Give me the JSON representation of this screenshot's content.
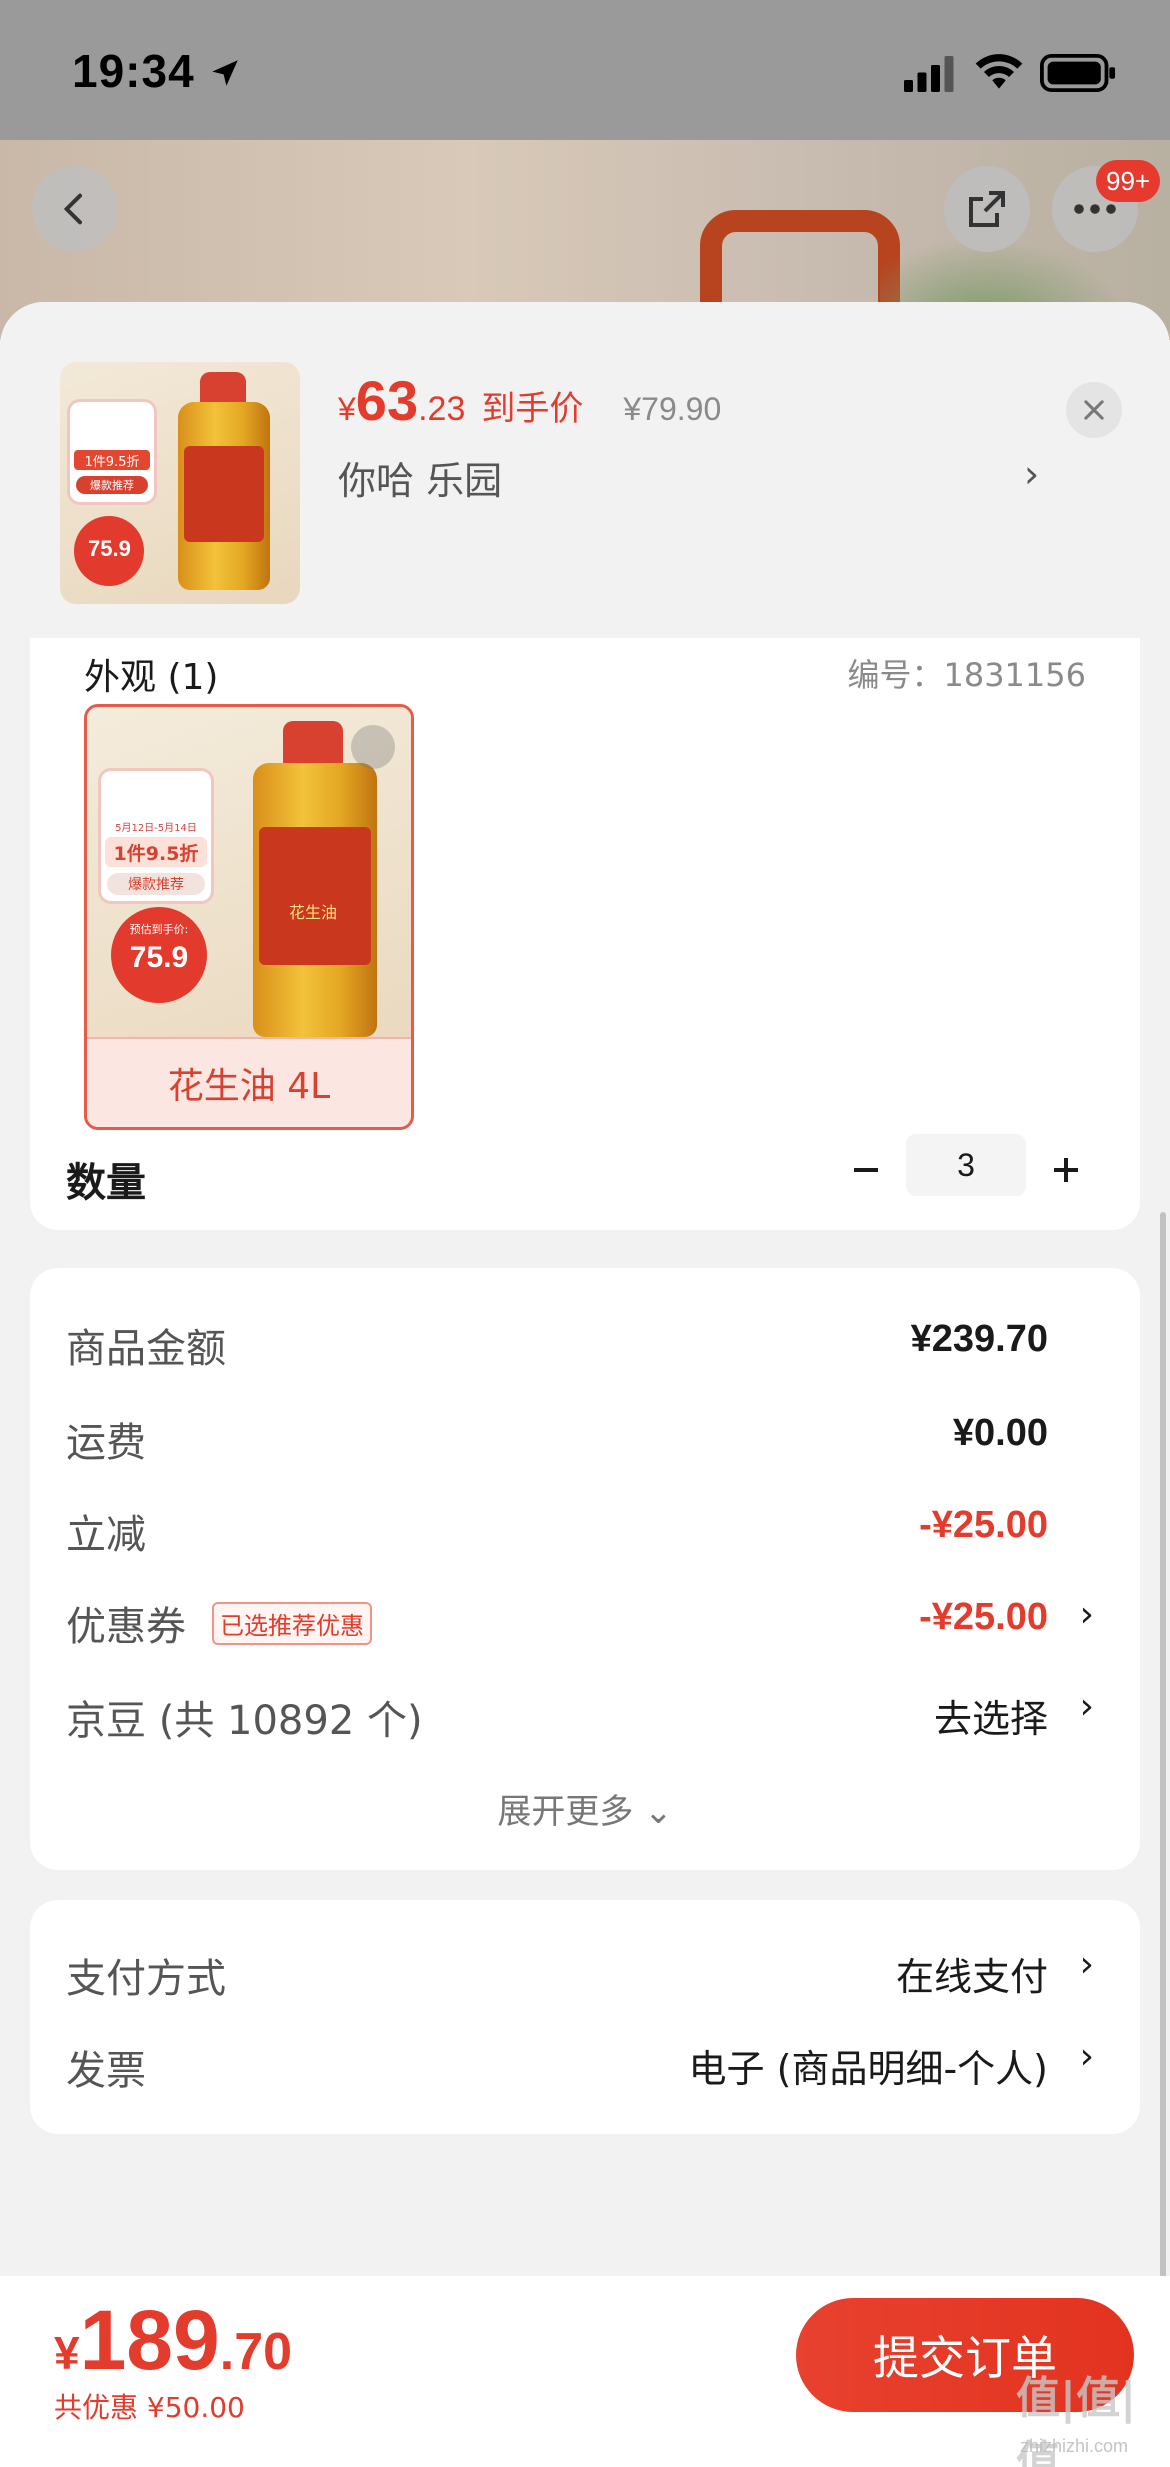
{
  "status_bar": {
    "time": "19:34"
  },
  "header": {
    "cart_badge": "99+"
  },
  "product_summary": {
    "price_symbol": "¥",
    "price_integer": "63",
    "price_decimal": ".23",
    "price_tag": "到手价",
    "original_price": "¥79.90",
    "address": "你哈  乐园",
    "thumb_promo": "1件9.5折",
    "thumb_hot": "爆款推荐",
    "thumb_price": "75.9"
  },
  "spec": {
    "title": "外观 (1)",
    "sku_code": "编号：1831156",
    "variant": {
      "label": "花生油 4L",
      "promo_date": "5月12日-5月14日",
      "promo": "1件9.5折",
      "hot": "爆款推荐",
      "pre_price_label": "预估到手价:",
      "pre_price": "75.9",
      "bottle_text": "花生油"
    },
    "quantity_label": "数量",
    "quantity": "3"
  },
  "fees": {
    "rows": [
      {
        "label": "商品金额",
        "value": "¥239.70"
      },
      {
        "label": "运费",
        "value": "¥0.00"
      },
      {
        "label": "立减",
        "value": "-¥25.00"
      },
      {
        "label": "优惠券",
        "tag": "已选推荐优惠",
        "value": "-¥25.00"
      },
      {
        "label": "京豆 (共 10892 个)",
        "value": "去选择"
      }
    ],
    "expand_more": "展开更多 ⌄"
  },
  "payment": {
    "method_label": "支付方式",
    "method_value": "在线支付",
    "invoice_label": "发票",
    "invoice_value": "电子 (商品明细-个人)"
  },
  "bottom": {
    "total_symbol": "¥",
    "total_integer": "189",
    "total_decimal": ".70",
    "saving": "共优惠 ¥50.00",
    "submit": "提交订单",
    "watermark": "值|值|值",
    "watermark_sub": "zhizhizhi.com"
  },
  "colors": {
    "accent": "#e33b2c",
    "background": "#f2f2f2",
    "card": "#ffffff"
  }
}
